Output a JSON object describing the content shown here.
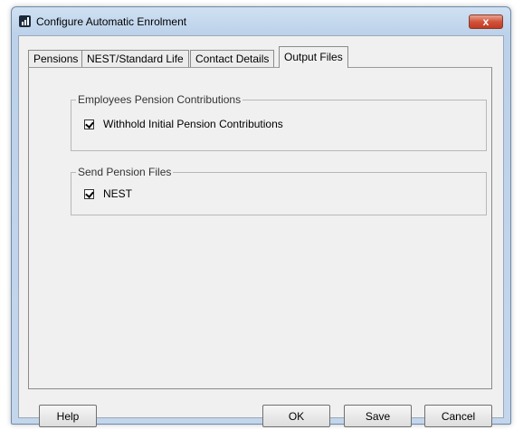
{
  "window": {
    "title": "Configure Automatic Enrolment",
    "close_label": "x"
  },
  "tabs": [
    {
      "label": "Pensions"
    },
    {
      "label": "NEST/Standard Life"
    },
    {
      "label": "Contact Details"
    },
    {
      "label": "Output Files",
      "selected": true
    }
  ],
  "groups": {
    "contributions": {
      "legend": "Employees Pension Contributions",
      "checkbox_label": "Withhold Initial Pension Contributions",
      "checked": true
    },
    "files": {
      "legend": "Send Pension Files",
      "checkbox_label": "NEST",
      "checked": true
    }
  },
  "buttons": {
    "help": "Help",
    "ok": "OK",
    "save": "Save",
    "cancel": "Cancel"
  },
  "colors": {
    "title_gradient_top": "#cfe0f2",
    "close_red": "#c13a20",
    "client_bg": "#f0f0f0"
  }
}
